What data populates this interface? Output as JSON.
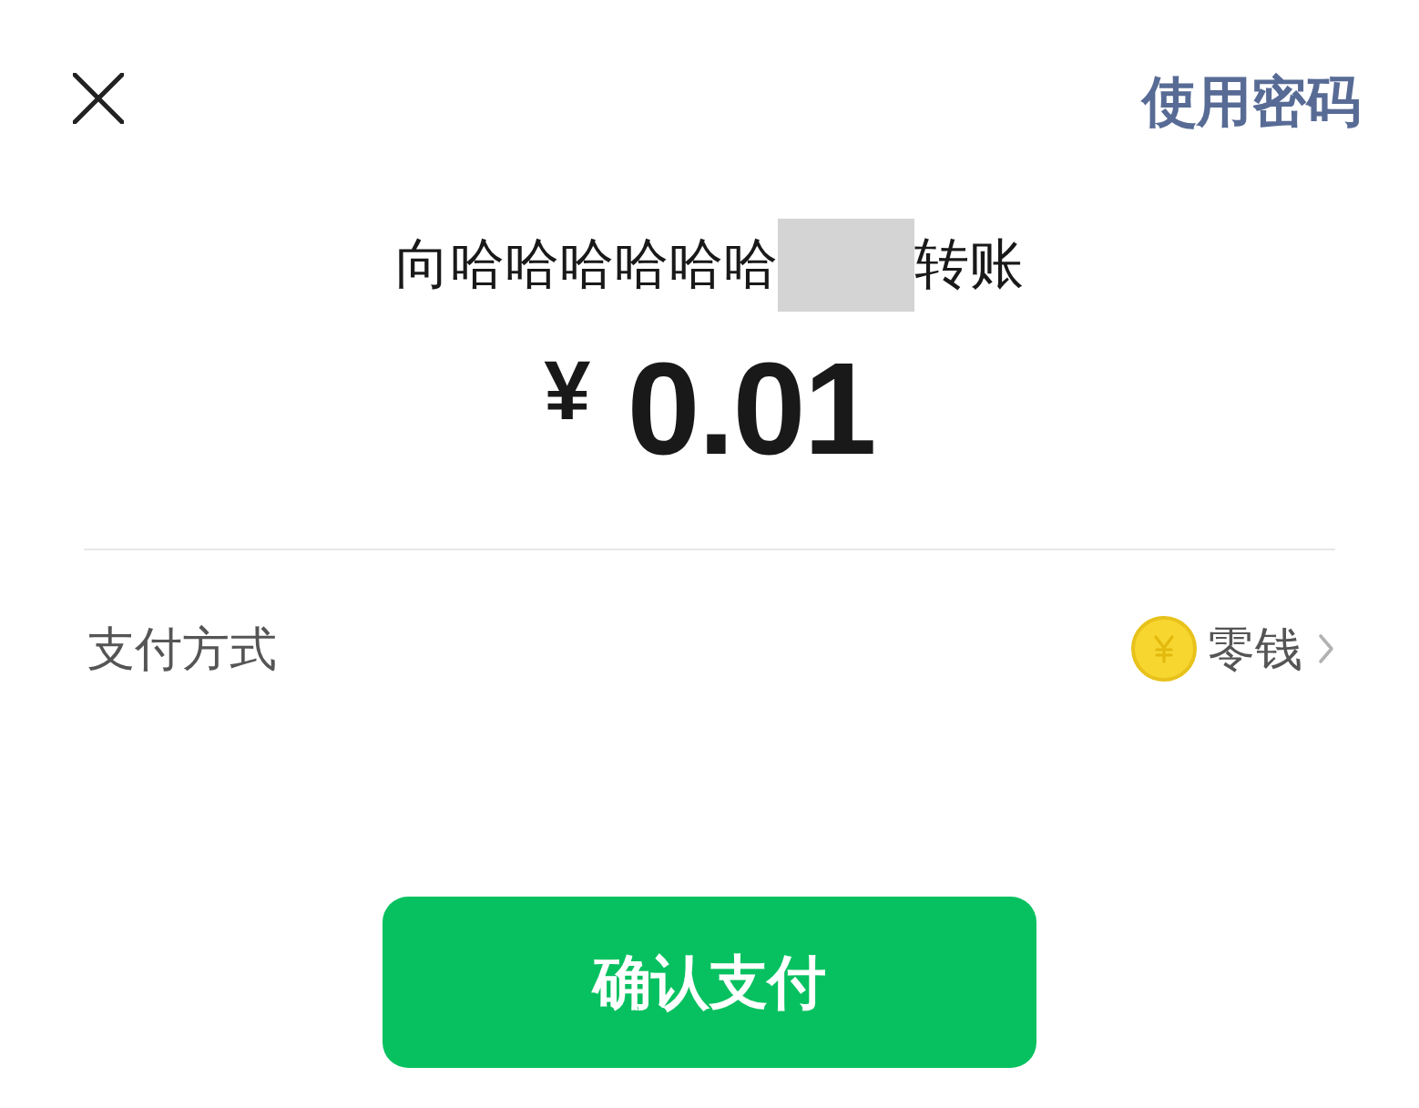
{
  "header": {
    "link": "使用密码"
  },
  "transfer": {
    "prefix": "向哈哈哈哈哈哈",
    "redacted": true,
    "suffix": "转账",
    "currency": "¥",
    "amount": "0.01"
  },
  "payment_method": {
    "label": "支付方式",
    "value": "零钱"
  },
  "confirm_button": "确认支付"
}
